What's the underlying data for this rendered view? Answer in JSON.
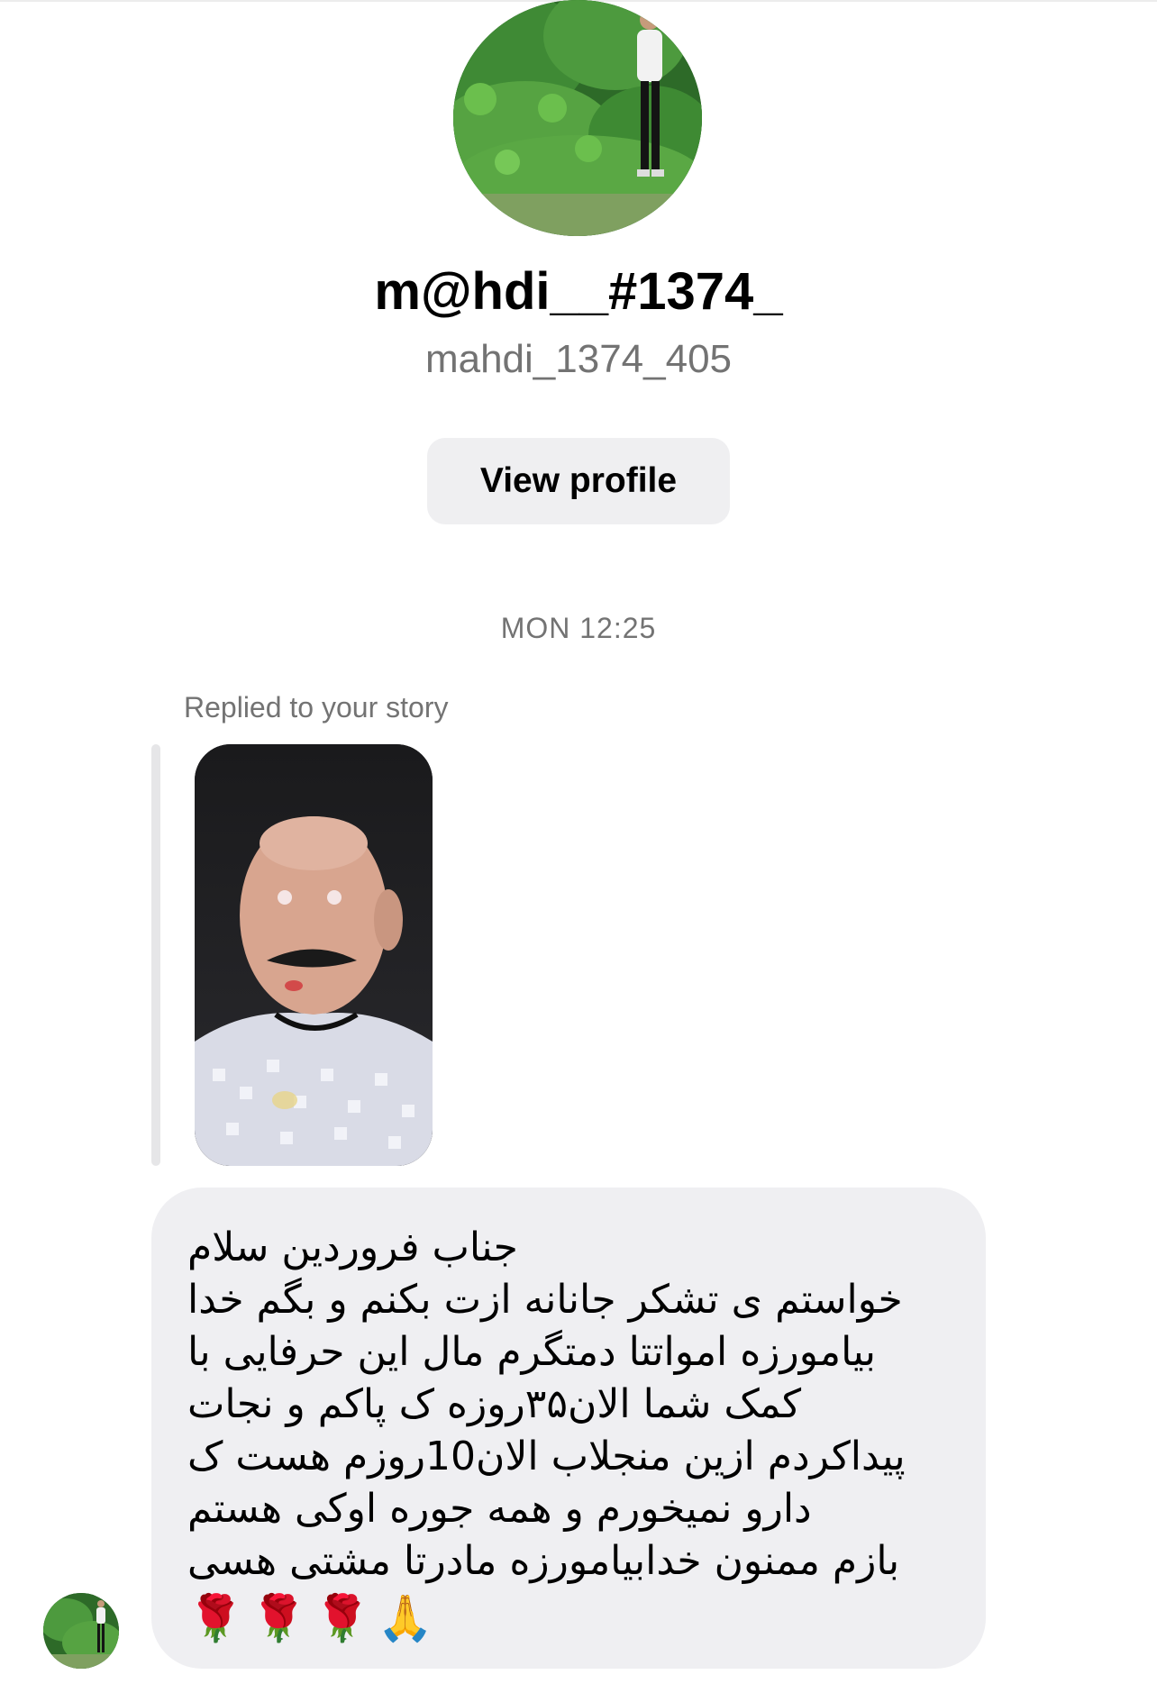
{
  "header": {
    "display_name": "m@hdi__#1374_",
    "username": "mahdi_1374_405",
    "view_profile_label": "View profile",
    "avatar_icon": "profile-photo"
  },
  "thread": {
    "timestamp": "MON 12:25",
    "story_reply_label": "Replied to your story",
    "message": {
      "text": "جناب فروردین سلام\nخواستم ی تشکر جانانه ازت بکنم و بگم خدا بیامورزه امواتتا دمتگرم مال این حرفایی با کمک شما الان۳۵روزه ک پاکم و نجات پیداکردم ازین منجلاب الان10روزم هست ک دارو نمیخورم و همه جوره اوکی هستم\nبازم ممنون خدابیامورزه مادرتا مشتی هسی",
      "emojis": [
        "🌹",
        "🌹",
        "🌹",
        "🙏"
      ]
    }
  },
  "colors": {
    "background": "#ffffff",
    "bubble": "#efeff2",
    "button": "#efeff1",
    "secondary_text": "#737373"
  }
}
